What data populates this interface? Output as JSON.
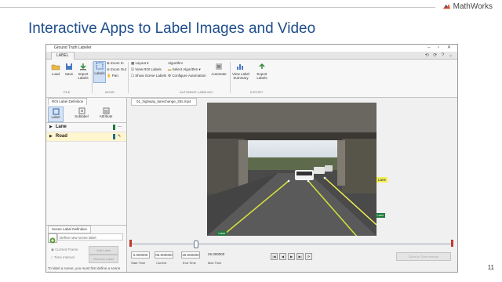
{
  "slide": {
    "title": "Interactive Apps to Label Images and Video",
    "brand": "MathWorks",
    "page_number": "11"
  },
  "app": {
    "window_title": "Ground Truth Labeler",
    "ribbon_tab": "LABEL",
    "ribbon": {
      "load": "Load",
      "save": "Save",
      "import": "Import Labels",
      "labels": "Labels",
      "zoom_in": "Zoom In",
      "zoom_out": "Zoom Out",
      "pan": "Pan",
      "layout": "Layout",
      "view_roi": "View ROI Labels",
      "show_scene": "Show Scene Labels",
      "algorithm_title": "Algorithm",
      "select_algorithm": "Select Algorithm",
      "configure_automation": "Configure Automation",
      "automate": "Automate",
      "view_label_summary": "View Label Summary",
      "export_labels": "Export Labels",
      "sec_file": "FILE",
      "sec_mode": "MODE",
      "sec_automate": "AUTOMATE LABELING",
      "sec_export": "EXPORT"
    },
    "left_panel": {
      "roi_tab": "ROI Label Definition",
      "tools": [
        "Label",
        "Sublabel",
        "Attribute"
      ],
      "labels": [
        {
          "name": "Lane",
          "color": "#1e7a3a"
        },
        {
          "name": "Road",
          "color": "#1a6e8c"
        }
      ],
      "scene_tab": "Scene Label Definition",
      "scene_placeholder": "Define new scene label",
      "current_frame": "Current Frame",
      "time_interval": "Time Interval",
      "add_label": "Add Label",
      "remove_label": "Remove Label",
      "help_text": "To label a scene, you must first define a scene label."
    },
    "document_tab": "01_highway_lanechange_25s.mp4",
    "frame_labels": {
      "lane_right": "Lane",
      "lane_mid": "Lane",
      "lane_left": "Lane"
    },
    "playback": {
      "start_time": "0.000000",
      "current": "05.000000",
      "end_time": "25.000000",
      "max_time": "25.000000",
      "start_label": "Start Time",
      "current_label": "Current",
      "end_label": "End Time",
      "max_label": "Max Time",
      "progress": 0.2,
      "controls": [
        "|◀",
        "◀",
        "▶",
        "▶|",
        "⟳"
      ],
      "zoom_button": "Zoom in Time Interval"
    }
  }
}
